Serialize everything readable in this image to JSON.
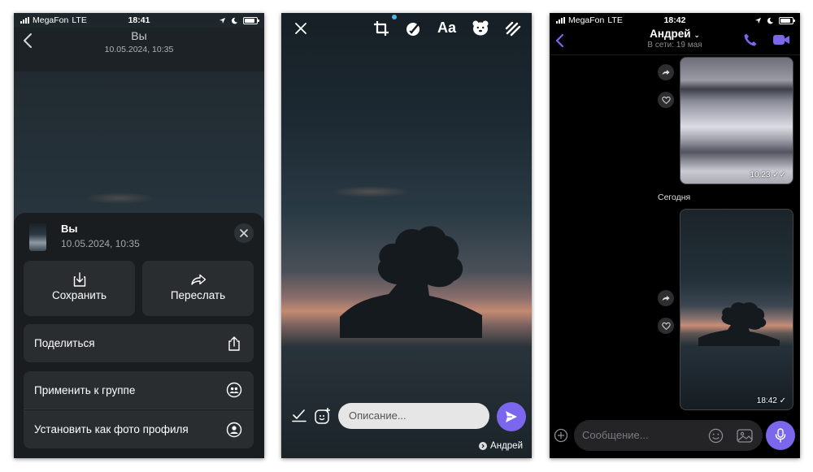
{
  "status_bar": {
    "carrier": "MegaFon",
    "network": "LTE",
    "time_left": "18:41",
    "time_right": "18:42",
    "battery_percent": 85
  },
  "viewer": {
    "title": "Вы",
    "date": "10.05.2024, 10:35"
  },
  "share_sheet": {
    "sender": "Вы",
    "date": "10.05.2024, 10:35",
    "save_label": "Сохранить",
    "forward_label": "Переслать",
    "share_label": "Поделиться",
    "apply_group_label": "Применить к группе",
    "set_profile_label": "Установить как фото профиля"
  },
  "editor": {
    "text_tool_label": "Aa",
    "caption_placeholder": "Описание...",
    "recipient": "Андрей",
    "accent_color": "#7b67ee"
  },
  "chat": {
    "contact_name": "Андрей",
    "last_seen": "В сети: 19 мая",
    "first_image_time": "10:23",
    "date_separator": "Сегодня",
    "second_image_time": "18:42",
    "message_placeholder": "Сообщение...",
    "accent_color": "#7b67ee"
  }
}
